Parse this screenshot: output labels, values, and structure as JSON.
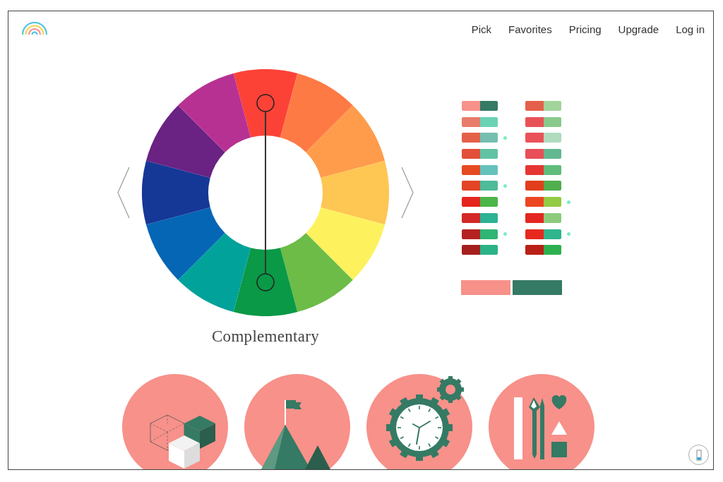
{
  "nav": [
    "Pick",
    "Favorites",
    "Pricing",
    "Upgrade",
    "Log in"
  ],
  "wheel": {
    "segments": [
      {
        "color": "#fc4237",
        "selected": true
      },
      {
        "color": "#fe7a45",
        "selected": false
      },
      {
        "color": "#fe9c4c",
        "selected": false
      },
      {
        "color": "#fec652",
        "selected": false
      },
      {
        "color": "#fdf25e",
        "selected": false
      },
      {
        "color": "#6cbc47",
        "selected": false
      },
      {
        "color": "#0a9946",
        "selected": true
      },
      {
        "color": "#00a29a",
        "selected": false
      },
      {
        "color": "#0566b6",
        "selected": false
      },
      {
        "color": "#153897",
        "selected": false
      },
      {
        "color": "#6a2283",
        "selected": false
      },
      {
        "color": "#b73192",
        "selected": false
      }
    ],
    "mode": "Complementary"
  },
  "pairs": [
    {
      "swatches": [
        {
          "color": "#f7918a"
        },
        {
          "color": "#357a64"
        }
      ],
      "marked": false
    },
    {
      "swatches": [
        {
          "color": "#e87c6a"
        },
        {
          "color": "#6ad3b4"
        }
      ],
      "marked": false
    },
    {
      "swatches": [
        {
          "color": "#e36148"
        },
        {
          "color": "#74bfb0"
        }
      ],
      "marked": true
    },
    {
      "swatches": [
        {
          "color": "#e24f3a"
        },
        {
          "color": "#60c3a3"
        }
      ],
      "marked": false
    },
    {
      "swatches": [
        {
          "color": "#e64a22"
        },
        {
          "color": "#64c2bd"
        }
      ],
      "marked": false
    },
    {
      "swatches": [
        {
          "color": "#e34426"
        },
        {
          "color": "#4ebb9a"
        }
      ],
      "marked": true
    },
    {
      "swatches": [
        {
          "color": "#e5261f"
        },
        {
          "color": "#4bb649"
        }
      ],
      "marked": false
    },
    {
      "swatches": [
        {
          "color": "#d32827"
        },
        {
          "color": "#2bb394"
        }
      ],
      "marked": false
    },
    {
      "swatches": [
        {
          "color": "#b42221"
        },
        {
          "color": "#2fb574"
        }
      ],
      "marked": true
    },
    {
      "swatches": [
        {
          "color": "#a41f1e"
        },
        {
          "color": "#2bb387"
        }
      ],
      "marked": false
    },
    {
      "swatches": [
        {
          "color": "#e4604a"
        },
        {
          "color": "#a1d49a"
        }
      ],
      "marked": false
    },
    {
      "swatches": [
        {
          "color": "#e85257"
        },
        {
          "color": "#8ac98c"
        }
      ],
      "marked": false
    },
    {
      "swatches": [
        {
          "color": "#ea5259"
        },
        {
          "color": "#b0dbbe"
        }
      ],
      "marked": false
    },
    {
      "swatches": [
        {
          "color": "#e84f58"
        },
        {
          "color": "#63b892"
        }
      ],
      "marked": false
    },
    {
      "swatches": [
        {
          "color": "#e53632"
        },
        {
          "color": "#61bc7c"
        }
      ],
      "marked": false
    },
    {
      "swatches": [
        {
          "color": "#e23e1c"
        },
        {
          "color": "#50ae4d"
        }
      ],
      "marked": false
    },
    {
      "swatches": [
        {
          "color": "#eb4621"
        },
        {
          "color": "#93cb45"
        }
      ],
      "marked": true
    },
    {
      "swatches": [
        {
          "color": "#e32621"
        },
        {
          "color": "#8ccb7e"
        }
      ],
      "marked": false
    },
    {
      "swatches": [
        {
          "color": "#e6281f"
        },
        {
          "color": "#30b58d"
        }
      ],
      "marked": true
    },
    {
      "swatches": [
        {
          "color": "#b92016"
        },
        {
          "color": "#2fb04f"
        }
      ],
      "marked": false
    }
  ],
  "selected_pair": [
    {
      "color": "#f7918a"
    },
    {
      "color": "#357a64"
    }
  ],
  "illustrations": [
    {
      "kind": "cubes"
    },
    {
      "kind": "mountain"
    },
    {
      "kind": "clock"
    },
    {
      "kind": "tools"
    }
  ]
}
